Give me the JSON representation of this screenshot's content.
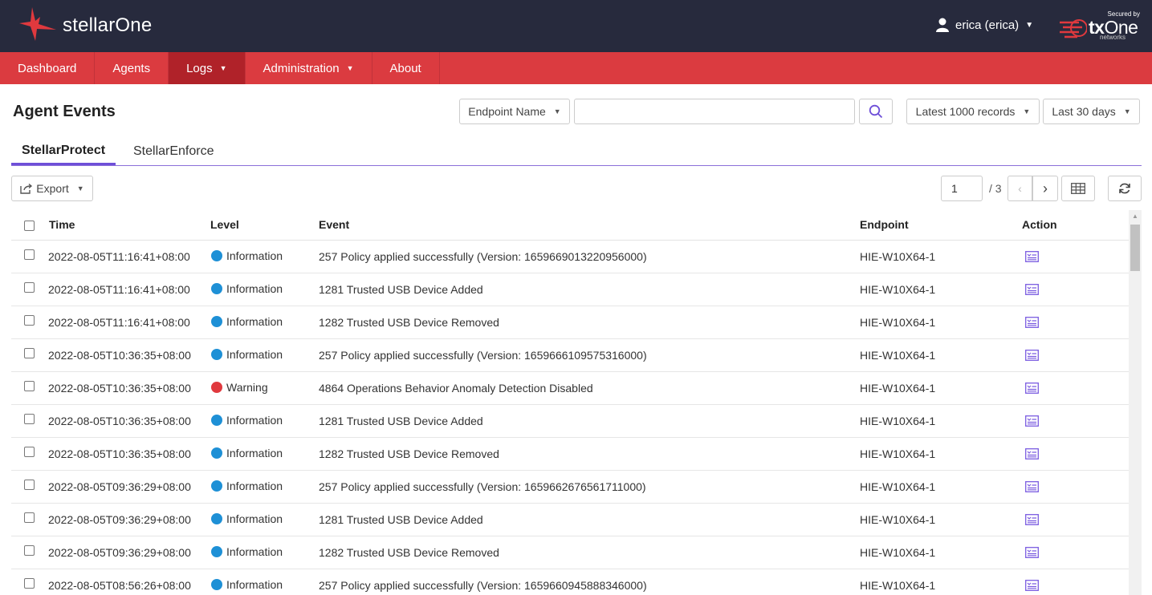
{
  "header": {
    "app_name": "stellarOne",
    "user_label": "erica (erica)",
    "secured_by": "Secured by",
    "brand_bold": "tx",
    "brand_rest": "One",
    "brand_sub": "networks"
  },
  "nav": {
    "items": [
      {
        "label": "Dashboard"
      },
      {
        "label": "Agents"
      },
      {
        "label": "Logs",
        "active": true
      },
      {
        "label": "Administration"
      },
      {
        "label": "About"
      }
    ]
  },
  "page": {
    "title": "Agent Events",
    "filter_field": "Endpoint Name",
    "search_value": "",
    "records": "Latest 1000 records",
    "period": "Last 30 days"
  },
  "tabs": [
    {
      "label": "StellarProtect",
      "active": true
    },
    {
      "label": "StellarEnforce"
    }
  ],
  "toolbar": {
    "export_label": "Export",
    "page": "1",
    "total_pages": "/ 3"
  },
  "table": {
    "headers": {
      "time": "Time",
      "level": "Level",
      "event": "Event",
      "endpoint": "Endpoint",
      "action": "Action"
    },
    "rows": [
      {
        "time": "2022-08-05T11:16:41+08:00",
        "level": "Information",
        "event": "257 Policy applied successfully (Version: 1659669013220956000)",
        "endpoint": "HIE-W10X64-1"
      },
      {
        "time": "2022-08-05T11:16:41+08:00",
        "level": "Information",
        "event": "1281 Trusted USB Device Added",
        "endpoint": "HIE-W10X64-1"
      },
      {
        "time": "2022-08-05T11:16:41+08:00",
        "level": "Information",
        "event": "1282 Trusted USB Device Removed",
        "endpoint": "HIE-W10X64-1"
      },
      {
        "time": "2022-08-05T10:36:35+08:00",
        "level": "Information",
        "event": "257 Policy applied successfully (Version: 1659666109575316000)",
        "endpoint": "HIE-W10X64-1"
      },
      {
        "time": "2022-08-05T10:36:35+08:00",
        "level": "Warning",
        "event": "4864 Operations Behavior Anomaly Detection Disabled",
        "endpoint": "HIE-W10X64-1"
      },
      {
        "time": "2022-08-05T10:36:35+08:00",
        "level": "Information",
        "event": "1281 Trusted USB Device Added",
        "endpoint": "HIE-W10X64-1"
      },
      {
        "time": "2022-08-05T10:36:35+08:00",
        "level": "Information",
        "event": "1282 Trusted USB Device Removed",
        "endpoint": "HIE-W10X64-1"
      },
      {
        "time": "2022-08-05T09:36:29+08:00",
        "level": "Information",
        "event": "257 Policy applied successfully (Version: 1659662676561711000)",
        "endpoint": "HIE-W10X64-1"
      },
      {
        "time": "2022-08-05T09:36:29+08:00",
        "level": "Information",
        "event": "1281 Trusted USB Device Added",
        "endpoint": "HIE-W10X64-1"
      },
      {
        "time": "2022-08-05T09:36:29+08:00",
        "level": "Information",
        "event": "1282 Trusted USB Device Removed",
        "endpoint": "HIE-W10X64-1"
      },
      {
        "time": "2022-08-05T08:56:26+08:00",
        "level": "Information",
        "event": "257 Policy applied successfully (Version: 1659660945888346000)",
        "endpoint": "HIE-W10X64-1"
      }
    ]
  },
  "colors": {
    "header_bg": "#272a3d",
    "nav_bg": "#db3b40",
    "nav_active": "#b02229",
    "accent": "#6e4fd8",
    "info": "#1e90d6",
    "warning": "#e0393e"
  },
  "icons": {
    "user": "user-icon",
    "search": "search-icon",
    "export": "export-icon",
    "grid": "column-grid-icon",
    "refresh": "refresh-icon",
    "action": "event-detail-icon"
  }
}
